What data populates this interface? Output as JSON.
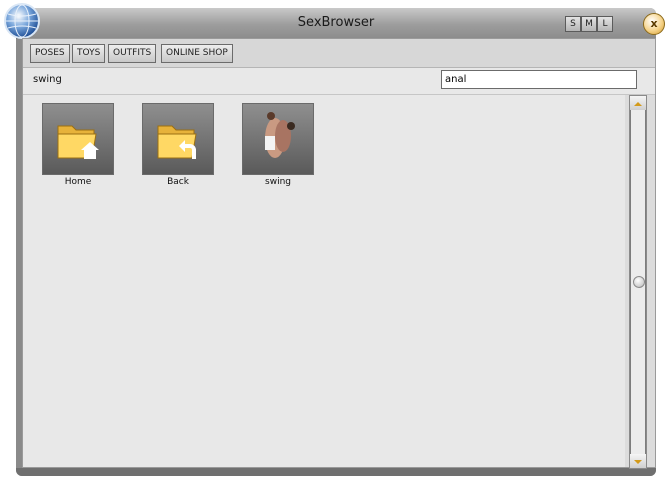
{
  "window": {
    "title": "SexBrowser"
  },
  "size_buttons": [
    "S",
    "M",
    "L"
  ],
  "close_label": "x",
  "tabs": [
    "POSES",
    "TOYS",
    "OUTFITS",
    "ONLINE SHOP"
  ],
  "path": {
    "current": "swing"
  },
  "search": {
    "value": "anal"
  },
  "items": [
    {
      "label": "Home",
      "icon": "folder-home-icon"
    },
    {
      "label": "Back",
      "icon": "folder-back-icon"
    },
    {
      "label": "swing",
      "icon": "pose-thumbnail"
    }
  ],
  "colors": {
    "accent_close": "#f6d48c",
    "chrome": "#9d9d9d",
    "panel": "#e8e8e8"
  }
}
